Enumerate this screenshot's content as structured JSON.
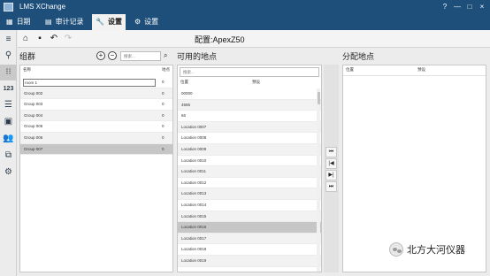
{
  "app": {
    "title": "LMS XChange"
  },
  "window_buttons": [
    "?",
    "—",
    "□",
    "×"
  ],
  "menu": [
    {
      "label": "日期",
      "icon": "calendar-icon",
      "glyph": "▦"
    },
    {
      "label": "审计记录",
      "icon": "document-icon",
      "glyph": "▤"
    },
    {
      "label": "设置",
      "icon": "wrench-icon",
      "glyph": "🔧",
      "active": true
    },
    {
      "label": "设置",
      "icon": "gear-icon",
      "glyph": "⚙"
    }
  ],
  "sidebar_icons": [
    "hamburger-menu-icon",
    "location-pin-icon",
    "group-link-icon",
    "numeric-icon",
    "list-edit-icon",
    "device-icon",
    "people-icon",
    "network-icon",
    "settings-gear-icon"
  ],
  "toolbar": {
    "config_title": "配置:ApexZ50"
  },
  "groups_panel": {
    "title": "组群",
    "search_placeholder": "搜索...",
    "col_name": "名称",
    "col_count": "地点",
    "rows": [
      {
        "name": "room 1",
        "count": "0"
      },
      {
        "name": "Group 002",
        "count": "0"
      },
      {
        "name": "Group 003",
        "count": "0"
      },
      {
        "name": "Group 004",
        "count": "0"
      },
      {
        "name": "Group 005",
        "count": "0"
      },
      {
        "name": "Group 006",
        "count": "0"
      },
      {
        "name": "Group 007",
        "count": "0"
      }
    ]
  },
  "available_panel": {
    "title": "可用的地点",
    "search_placeholder": "搜索...",
    "col_location": "位置",
    "col_reserved": "预设",
    "rows": [
      "00000",
      "4555",
      "66",
      "Location 0007",
      "Location 0008",
      "Location 0009",
      "Location 0010",
      "Location 0011",
      "Location 0012",
      "Location 0013",
      "Location 0014",
      "Location 0015",
      "Location 0016",
      "Location 0017",
      "Location 0018",
      "Location 0019"
    ]
  },
  "assigned_panel": {
    "title": "分配地点",
    "col_location": "位置",
    "col_reserved": "预设"
  },
  "transfer_buttons": [
    "⏮",
    "|◀",
    "▶|",
    "⏭"
  ],
  "watermark": {
    "text": "北方大河仪器"
  }
}
